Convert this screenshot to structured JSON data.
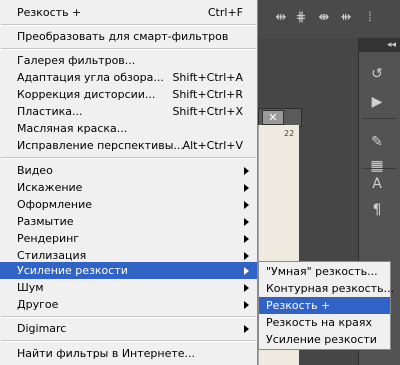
{
  "menu": {
    "items": [
      {
        "label": "Резкость +",
        "shortcut": "Ctrl+F"
      },
      {
        "label": "Преобразовать для смарт-фильтров",
        "shortcut": ""
      },
      {
        "label": "Галерея фильтров...",
        "shortcut": ""
      },
      {
        "label": "Адаптация угла обзора...",
        "shortcut": "Shift+Ctrl+A"
      },
      {
        "label": "Коррекция дисторсии...",
        "shortcut": "Shift+Ctrl+R"
      },
      {
        "label": "Пластика...",
        "shortcut": "Shift+Ctrl+X"
      },
      {
        "label": "Масляная краска...",
        "shortcut": ""
      },
      {
        "label": "Исправление перспективы...",
        "shortcut": "Alt+Ctrl+V"
      },
      {
        "label": "Видео"
      },
      {
        "label": "Искажение"
      },
      {
        "label": "Оформление"
      },
      {
        "label": "Размытие"
      },
      {
        "label": "Рендеринг"
      },
      {
        "label": "Стилизация"
      },
      {
        "label": "Усиление резкости"
      },
      {
        "label": "Шум"
      },
      {
        "label": "Другое"
      },
      {
        "label": "Digimarc"
      },
      {
        "label": "Найти фильтры в Интернете..."
      }
    ]
  },
  "submenu": {
    "items": [
      {
        "label": "\"Умная\" резкость..."
      },
      {
        "label": "Контурная резкость..."
      },
      {
        "label": "Резкость +"
      },
      {
        "label": "Резкость на краях"
      },
      {
        "label": "Усиление резкости"
      }
    ]
  },
  "document": {
    "close_label": "✕",
    "ruler_mark": "22"
  },
  "panel": {
    "collapse_label": "◂◂"
  },
  "colors": {
    "highlight": "#3163c6",
    "menu_bg": "#f0f0f0",
    "app_bg": "#3b3b3b"
  }
}
